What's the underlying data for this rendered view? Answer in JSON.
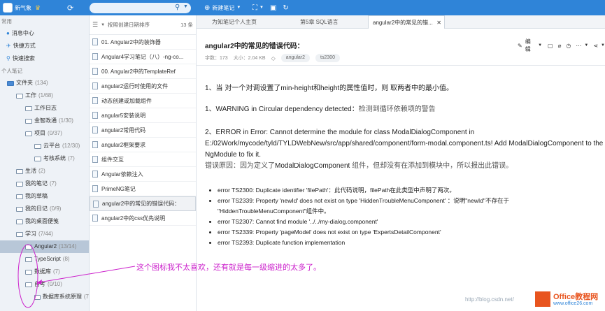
{
  "topbar": {
    "username": "新气象",
    "new_note": "新建笔记",
    "search_placeholder": ""
  },
  "sidebar": {
    "section_common": "常用",
    "message_center": "消息中心",
    "quick_access": "快捷方式",
    "quick_search": "快速搜索",
    "section_notes": "个人笔记",
    "items": [
      {
        "label": "文件夹",
        "count": "(134)"
      },
      {
        "label": "工作",
        "count": "(1/68)"
      },
      {
        "label": "工作日志",
        "count": ""
      },
      {
        "label": "金智政通",
        "count": "(1/30)"
      },
      {
        "label": "项目",
        "count": "(0/37)"
      },
      {
        "label": "云平台",
        "count": "(12/30)"
      },
      {
        "label": "考核系统",
        "count": "(7)"
      },
      {
        "label": "生活",
        "count": "(2)"
      },
      {
        "label": "我的笔记",
        "count": "(7)"
      },
      {
        "label": "我的草稿",
        "count": ""
      },
      {
        "label": "我的日记",
        "count": "(0/9)"
      },
      {
        "label": "我的桌面便笺",
        "count": ""
      },
      {
        "label": "学习",
        "count": "(7/44)"
      },
      {
        "label": "Angular2",
        "count": "(13/14)"
      },
      {
        "label": "TypeScript",
        "count": "(8)"
      },
      {
        "label": "数据库",
        "count": "(7)"
      },
      {
        "label": "自考",
        "count": "(0/10)"
      },
      {
        "label": "数据库系统原理",
        "count": "(7"
      }
    ]
  },
  "list": {
    "sort_label": "按照创建日期排序",
    "count": "13 条",
    "items": [
      "01. Angular2中的装饰器",
      "Angular4学习笔记（八）-ng-co...",
      "00. Angular2中的TemplateRef",
      "angular2运行时使用的文件",
      "动态创建或加载组件",
      "angular5安装说明",
      "angular2常用代码",
      "angular2框架要求",
      "组件交互",
      "Angular依赖注入",
      "PrimeNG笔记",
      "angular2中的常见的错误代码：",
      "angular2中的css优先说明"
    ]
  },
  "tabs": [
    "为知笔记个人主页",
    "第5章 SQL语言",
    "angular2中的常见的错..."
  ],
  "doc": {
    "title": "angular2中的常见的错误代码：",
    "words": "字数：173",
    "size": "大小：2.04 KB",
    "tags": [
      "angular2",
      "ts2300"
    ],
    "edit": "编辑",
    "p1": "1、当 对一个对调设置了min-height和height的属性值时，则 取两者中的最小值。",
    "p2a": "1、WARNING in Circular dependency detected：",
    "p2b": "检测到循环依赖项的警告",
    "p3a": "2、ERROR in Error: Cannot determine the module for class ModalDialogComponent in",
    "p3b": "E:/02Work/mycode/tyld/TYLDWebNew/src/app/shared/component/form-modal.component.ts! Add ModalDialogComponent to the",
    "p3c": "NgModule to fix it.",
    "p3d1": "错误原因：因为定义了",
    "p3d2": "ModalDialogComponent",
    "p3d3": "组件，但却没有在添加到模块中，所以报出此错误。",
    "errors": [
      "error TS2300: Duplicate identifier 'filePath'：此代码说明，filePath在此类型中声明了两次。",
      "error TS2339: Property 'newId' does not exist on type 'HiddenTroubleMenuComponent'    ：说明\"newId\"不存在于",
      "\"HiddenTroubleMenuComponent\"组件中。",
      "error TS2307: Cannot find module '../../my-dialog.component'",
      "error TS2339: Property 'pageModel' does not exist on type 'ExpertsDetailComponent'",
      "error TS2393: Duplicate function implementation"
    ]
  },
  "annotation": "这个图标我不太喜欢，还有就是每一级缩进的太多了。",
  "watermark": "http://blog.csdn.net/",
  "logo": {
    "line1": "Office教程网",
    "line2": "www.office26.com"
  },
  "colors": {
    "topbar": "#2f84d8",
    "sidebar": "#eef2f7",
    "annotation": "#cc22cc"
  }
}
